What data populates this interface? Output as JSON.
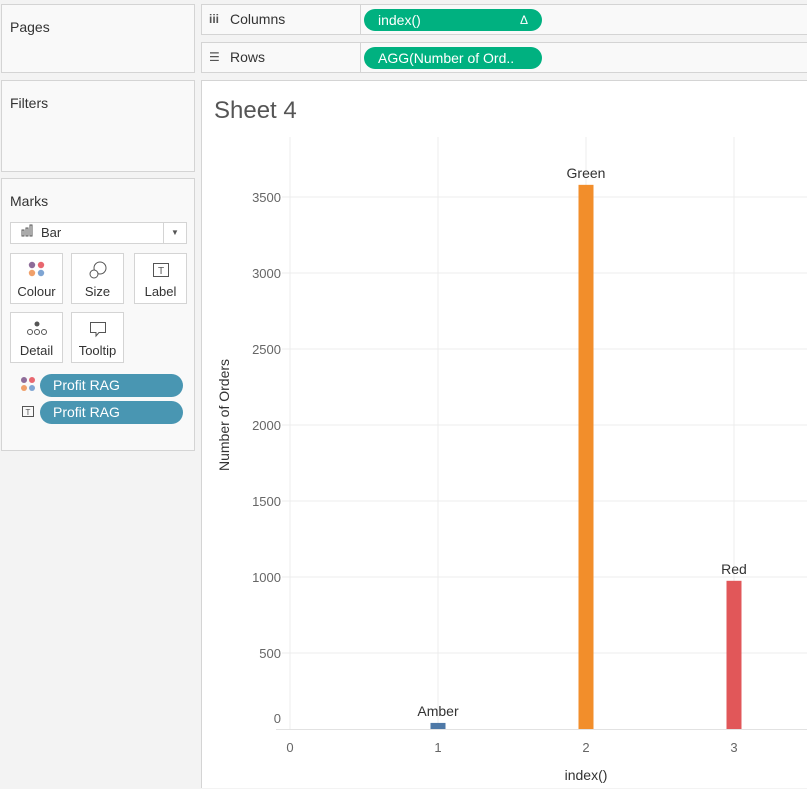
{
  "left_panel": {
    "pages_title": "Pages",
    "filters_title": "Filters",
    "marks_title": "Marks",
    "mark_type": "Bar",
    "mark_buttons": [
      {
        "label": "Colour",
        "icon": "colour-dots-icon"
      },
      {
        "label": "Size",
        "icon": "size-icon"
      },
      {
        "label": "Label",
        "icon": "label-text-icon"
      },
      {
        "label": "Detail",
        "icon": "detail-dots-icon"
      },
      {
        "label": "Tooltip",
        "icon": "tooltip-bubble-icon"
      }
    ],
    "mark_cards": [
      {
        "type": "colour",
        "field": "Profit RAG"
      },
      {
        "type": "label",
        "field": "Profit RAG"
      }
    ]
  },
  "shelves": {
    "columns_label": "Columns",
    "columns_pill": "index()",
    "columns_pill_badge": "Δ",
    "rows_label": "Rows",
    "rows_pill": "AGG(Number of Ord.."
  },
  "sheet": {
    "title": "Sheet 4"
  },
  "colors": {
    "pill_green": "#00b180",
    "pill_blue": "#4996b2",
    "amber": "#4e79a7",
    "green": "#f28e2b",
    "red": "#e15759"
  },
  "chart_data": {
    "type": "bar",
    "title": "Sheet 4",
    "xlabel": "index()",
    "ylabel": "Number of Orders",
    "x_ticks": [
      0,
      1,
      2,
      3
    ],
    "y_ticks": [
      0,
      500,
      1000,
      1500,
      2000,
      2500,
      3000,
      3500
    ],
    "xlim": [
      0,
      3.5
    ],
    "ylim": [
      0,
      3800
    ],
    "grid": true,
    "bars": [
      {
        "x": 1,
        "value": 40,
        "label": "Amber",
        "color": "#4e79a7"
      },
      {
        "x": 2,
        "value": 3580,
        "label": "Green",
        "color": "#f28e2b"
      },
      {
        "x": 3,
        "value": 975,
        "label": "Red",
        "color": "#e15759"
      }
    ]
  }
}
